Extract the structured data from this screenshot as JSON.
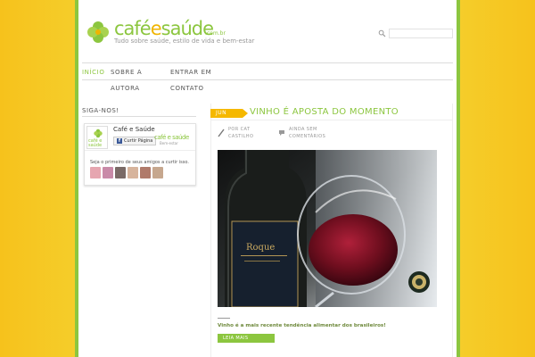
{
  "header": {
    "logo_word_left": "café",
    "logo_word_e": "e",
    "logo_word_right": "saúde",
    "logo_tld": ".com.br",
    "logo_tagline": "Tudo sobre saúde, estilo de vida e bem-estar"
  },
  "search": {
    "placeholder": "",
    "icon": "search-icon"
  },
  "nav": {
    "items": [
      {
        "label": "Início",
        "active": true
      },
      {
        "label": "Sobre a"
      },
      {
        "label": "Entrar em"
      },
      {
        "label": "Autora"
      },
      {
        "label": "Contato"
      }
    ]
  },
  "sidebar": {
    "title": "Siga-nos!",
    "facebook": {
      "page_name": "Café e Saúde",
      "like_label": "Curtir Página",
      "thumb_text": "café e saúde",
      "mini_logo": "café e saúde",
      "mini_tag": "Bem-estar",
      "friends_text": "Seja o primeiro de seus amigos a curtir isso."
    }
  },
  "post": {
    "date": "JUN",
    "title": "VINHO É APOSTA DO MOMENTO",
    "author_line1": "POR CAT",
    "author_line2": "CASTILHO",
    "comments_line1": "AINDA SEM",
    "comments_line2": "COMENTÁRIOS",
    "bottle_label": "Roque",
    "excerpt": "Vinho é a mais recente tendência alimentar dos brasileiros!",
    "read_more": "LEIA MAIS"
  },
  "colors": {
    "accent_green": "#8cc63f",
    "accent_yellow": "#f5b800",
    "background_yellow": "#f6c21c"
  }
}
